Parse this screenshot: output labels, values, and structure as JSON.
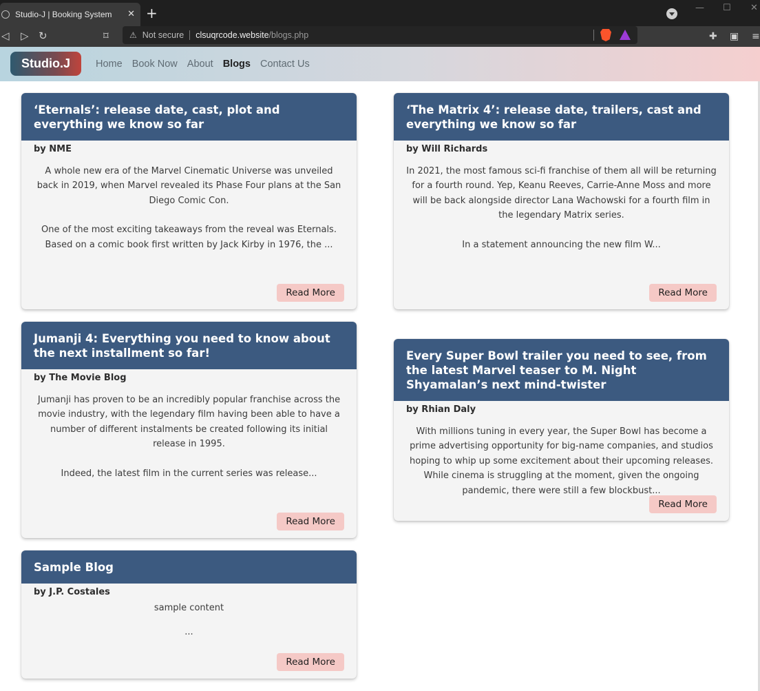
{
  "browser": {
    "tab_title": "Studio-J | Booking System",
    "tab_close": "✕",
    "new_tab": "+",
    "url_warning": "Not secure",
    "url_host": "clsuqrcode.website",
    "url_path": "/blogs.php",
    "back": "◁",
    "forward": "▷",
    "reload": "↻",
    "bookmark": "⌑"
  },
  "site": {
    "logo": "Studio.J",
    "nav": [
      {
        "label": "Home"
      },
      {
        "label": "Book Now"
      },
      {
        "label": "About"
      },
      {
        "label": "Blogs",
        "active": true
      },
      {
        "label": "Contact Us"
      }
    ]
  },
  "blogs": [
    {
      "title": "‘Eternals’: release date, cast, plot and everything we know so far",
      "author": "by NME",
      "paragraphs": [
        "A whole new era of the Marvel Cinematic Universe was unveiled back in 2019, when Marvel revealed its Phase Four plans at the San Diego Comic Con.",
        "",
        "One of the most exciting takeaways from the reveal was Eternals. Based on a comic book first written by Jack Kirby in 1976, the ..."
      ],
      "button": "Read More"
    },
    {
      "title": "‘The Matrix 4’: release date, trailers, cast and everything we know so far",
      "author": "by Will Richards",
      "paragraphs": [
        "In 2021, the most famous sci-fi franchise of them all will be returning for a fourth round. Yep, Keanu Reeves, Carrie-Anne Moss and more will be back alongside director Lana Wachowski for a fourth film in the legendary Matrix series.",
        "",
        "In a statement announcing the new film W..."
      ],
      "button": "Read More"
    },
    {
      "title": "Jumanji 4: Everything you need to know about the next installment so far!",
      "author": "by The Movie Blog",
      "paragraphs": [
        "Jumanji has proven to be an incredibly popular franchise across the movie industry, with the legendary film having been able to have a number of different instalments be created following its initial release in 1995.",
        "",
        "Indeed, the latest film in the current series was release..."
      ],
      "button": "Read More"
    },
    {
      "title": "Every Super Bowl trailer you need to see, from the latest Marvel teaser to M. Night Shyamalan’s next mind-twister",
      "author": "by Rhian Daly",
      "paragraphs": [
        "With millions tuning in every year, the Super Bowl has become a prime advertising opportunity for big-name companies, and studios hoping to whip up some excitement about their upcoming releases. While cinema is struggling at the moment, given the ongoing pandemic, there were still a few blockbust..."
      ],
      "button": "Read More"
    },
    {
      "title": "Sample Blog",
      "author": "by J.P. Costales",
      "paragraphs": [
        "sample content",
        "..."
      ],
      "button": "Read More"
    }
  ]
}
